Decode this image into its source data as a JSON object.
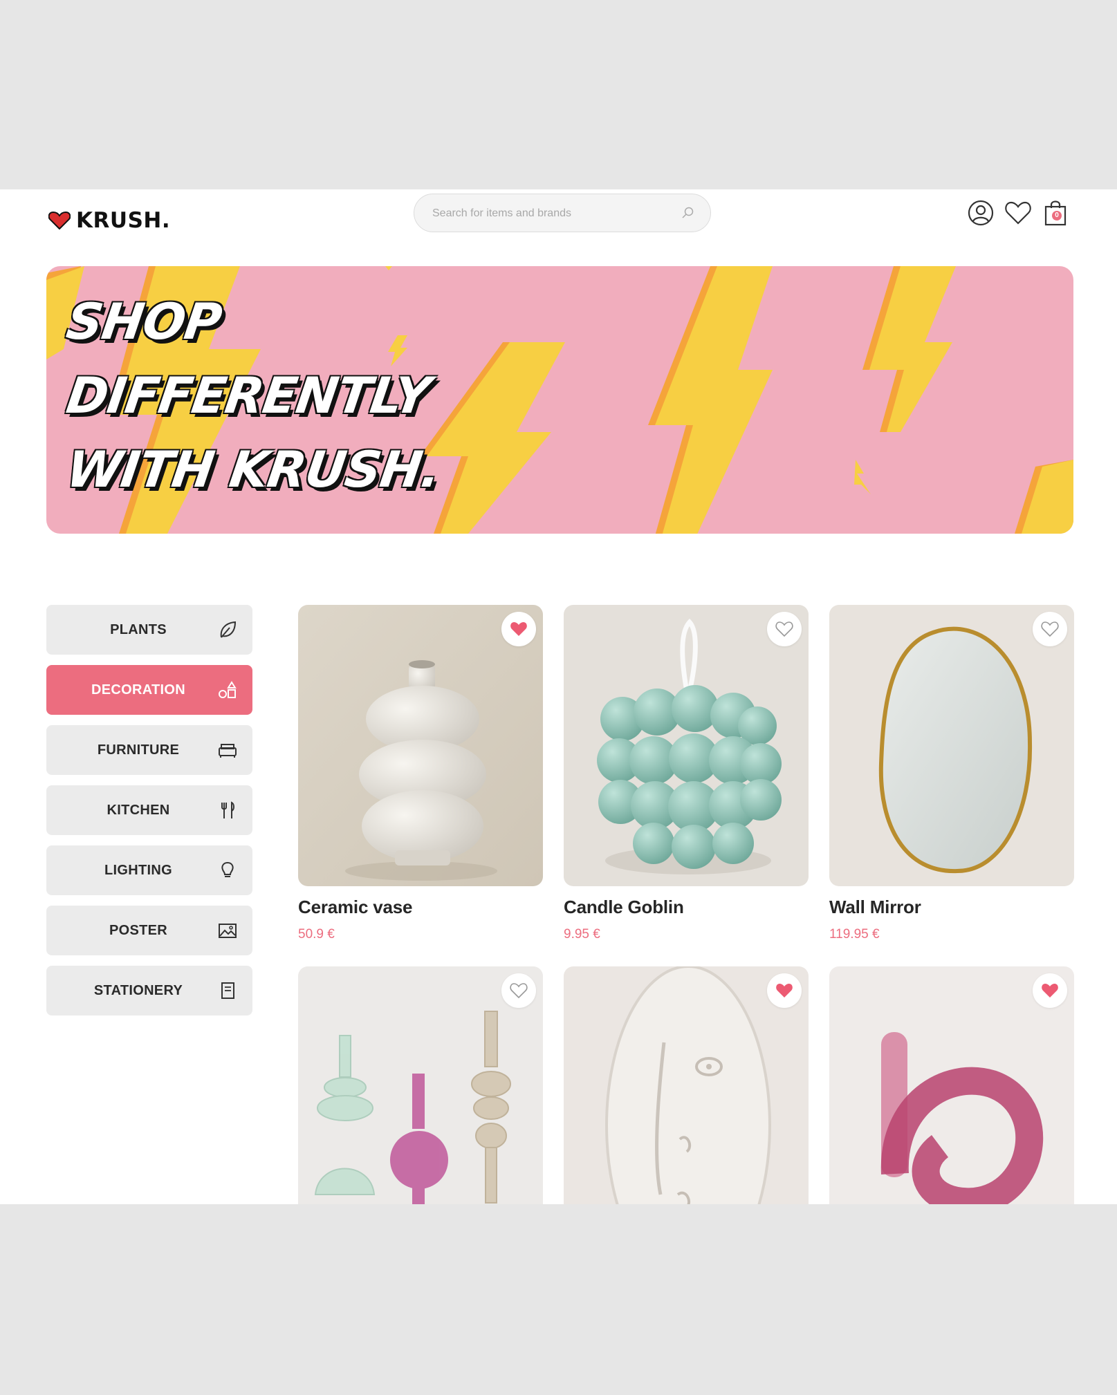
{
  "header": {
    "brand": "KRUSH.",
    "search_placeholder": "Search for items and brands",
    "cart_count": "0"
  },
  "banner": {
    "lines": [
      "SHOP",
      "DIFFERENTLY",
      "WITH KRUSH."
    ]
  },
  "categories": [
    {
      "label": "PLANTS",
      "icon": "leaf-icon",
      "active": false
    },
    {
      "label": "DECORATION",
      "icon": "shapes-icon",
      "active": true
    },
    {
      "label": "FURNITURE",
      "icon": "sofa-icon",
      "active": false
    },
    {
      "label": "KITCHEN",
      "icon": "cutlery-icon",
      "active": false
    },
    {
      "label": "LIGHTING",
      "icon": "bulb-icon",
      "active": false
    },
    {
      "label": "POSTER",
      "icon": "picture-icon",
      "active": false
    },
    {
      "label": "STATIONERY",
      "icon": "notebook-icon",
      "active": false
    }
  ],
  "products": [
    {
      "name": "Ceramic vase",
      "price": "50.9 €",
      "favorited": true
    },
    {
      "name": "Candle Goblin",
      "price": "9.95 €",
      "favorited": false
    },
    {
      "name": "Wall Mirror",
      "price": "119.95 €",
      "favorited": false
    },
    {
      "name": "",
      "price": "",
      "favorited": false
    },
    {
      "name": "",
      "price": "",
      "favorited": true
    },
    {
      "name": "",
      "price": "",
      "favorited": true
    }
  ],
  "colors": {
    "accent": "#ec6d7f",
    "banner_bg": "#f1adbd",
    "bolt": "#f7cf43"
  }
}
